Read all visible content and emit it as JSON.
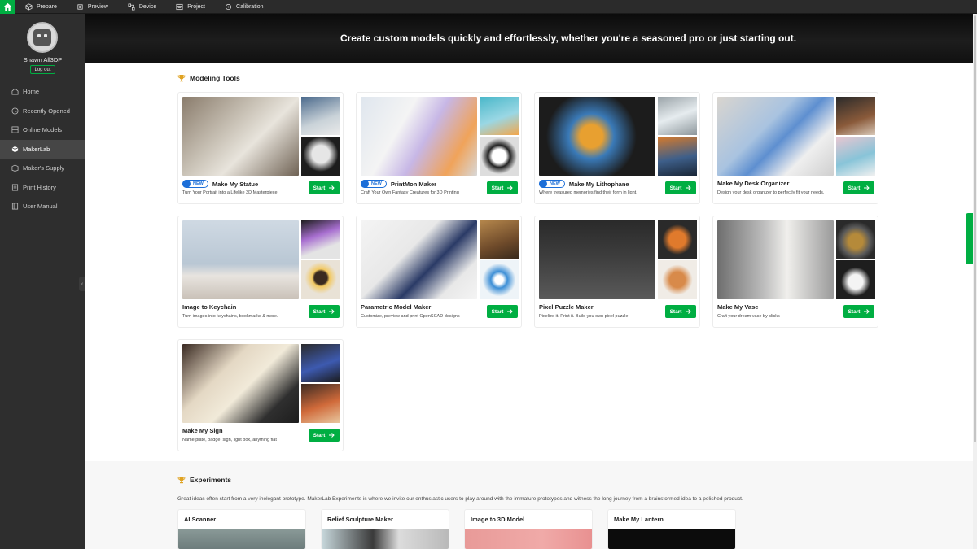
{
  "topbar": {
    "tabs": [
      {
        "label": "Prepare",
        "icon": "cube-icon"
      },
      {
        "label": "Preview",
        "icon": "eye-icon"
      },
      {
        "label": "Device",
        "icon": "device-icon"
      },
      {
        "label": "Project",
        "icon": "project-icon"
      },
      {
        "label": "Calibration",
        "icon": "calibration-icon"
      }
    ]
  },
  "sidebar": {
    "username": "Shawn All3DP",
    "logout_label": "Log out",
    "items": [
      {
        "label": "Home",
        "icon": "home-icon"
      },
      {
        "label": "Recently Opened",
        "icon": "clock-icon"
      },
      {
        "label": "Online Models",
        "icon": "globe-icon"
      },
      {
        "label": "MakerLab",
        "icon": "cube-icon"
      },
      {
        "label": "Maker's Supply",
        "icon": "box-icon"
      },
      {
        "label": "Print History",
        "icon": "history-icon"
      },
      {
        "label": "User Manual",
        "icon": "book-icon"
      }
    ],
    "active": "MakerLab"
  },
  "banner": {
    "text": "Create custom models quickly and effortlessly, whether you're a seasoned pro or just starting out."
  },
  "modeling_tools": {
    "title": "Modeling Tools",
    "start_label": "Start",
    "new_label": "NEW",
    "cards": [
      {
        "title": "Make My Statue",
        "desc": "Turn Your Portrait into a Lifelike 3D Masterpiece"
      },
      {
        "title": "PrintMon Maker",
        "desc": "Craft Your Own Fantasy Creatures for 3D Printing"
      },
      {
        "title": "Make My Lithophane",
        "desc": "Where treasured memories find their form in light."
      },
      {
        "title": "Make My Desk Organizer",
        "desc": "Design your desk organizer to perfectly fit your needs."
      },
      {
        "title": "Image to Keychain",
        "desc": "Turn images into keychains, bookmarks & more."
      },
      {
        "title": "Parametric Model Maker",
        "desc": "Customize, preview and print OpenSCAD designs"
      },
      {
        "title": "Pixel Puzzle Maker",
        "desc": "Pixelize it. Print it. Build you own pixel puzzle."
      },
      {
        "title": "Make My Vase",
        "desc": "Craft your dream vase by clicks"
      },
      {
        "title": "Make My Sign",
        "desc": "Name plate, badge, sign, light box, anything flat"
      }
    ]
  },
  "experiments": {
    "title": "Experiments",
    "description": "Great ideas often start from a very inelegant prototype. MakerLab Experiments is where we invite our enthusiastic users to play around with the immature prototypes and witness the long journey from a brainstormed idea to a polished product.",
    "cards": [
      {
        "title": "AI Scanner"
      },
      {
        "title": "Relief Sculpture Maker"
      },
      {
        "title": "Image to 3D Model"
      },
      {
        "title": "Make My Lantern"
      }
    ]
  },
  "colors": {
    "accent": "#00ae42",
    "badge": "#1d6fd8",
    "sidebar": "#2e2e2e"
  }
}
